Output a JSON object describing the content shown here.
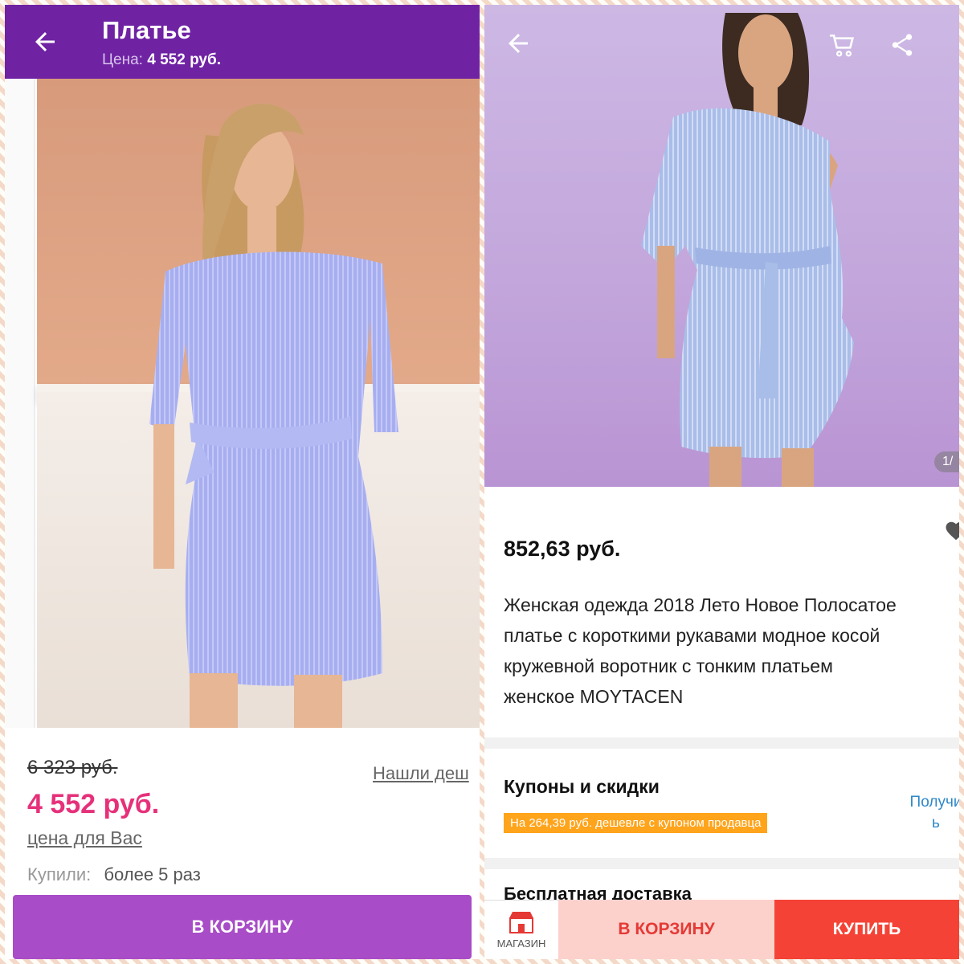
{
  "left": {
    "header": {
      "title": "Платье",
      "price_label": "Цена:",
      "price_value": "4 552 руб."
    },
    "carousel": {
      "pages": 3,
      "active": 1
    },
    "old_price": "6 323 руб.",
    "found_cheaper": "Нашли деш",
    "new_price": "4 552 руб.",
    "price_for_you": "цена для Вас",
    "bought_label": "Купили:",
    "bought_value": "более 5 раз",
    "cart_button": "В КОРЗИНУ",
    "colors": {
      "header": "#6f23a3",
      "price": "#e6307a",
      "cart_button": "#a84cc7"
    }
  },
  "right": {
    "counter": "1/",
    "price": "852,63 руб.",
    "description_lines": [
      "Женская одежда 2018 Лето Новое Полосатое",
      "платье с короткими рукавами модное косой",
      "кружевной воротник с тонким платьем",
      "женское MOYTACEN"
    ],
    "coupons_title": "Купоны и скидки",
    "coupon_badge": "На 264,39 руб. дешевле с купоном продавца",
    "get_link_line1": "Получи",
    "get_link_line2": "ь",
    "shipping": "Бесплатная доставка",
    "shop_label": "МАГАЗИН",
    "cart_button": "В КОРЗИНУ",
    "buy_button": "КУПИТЬ",
    "colors": {
      "badge": "#ffa41b",
      "cart_bg": "#fcd1cc",
      "buy_bg": "#f44336"
    }
  }
}
